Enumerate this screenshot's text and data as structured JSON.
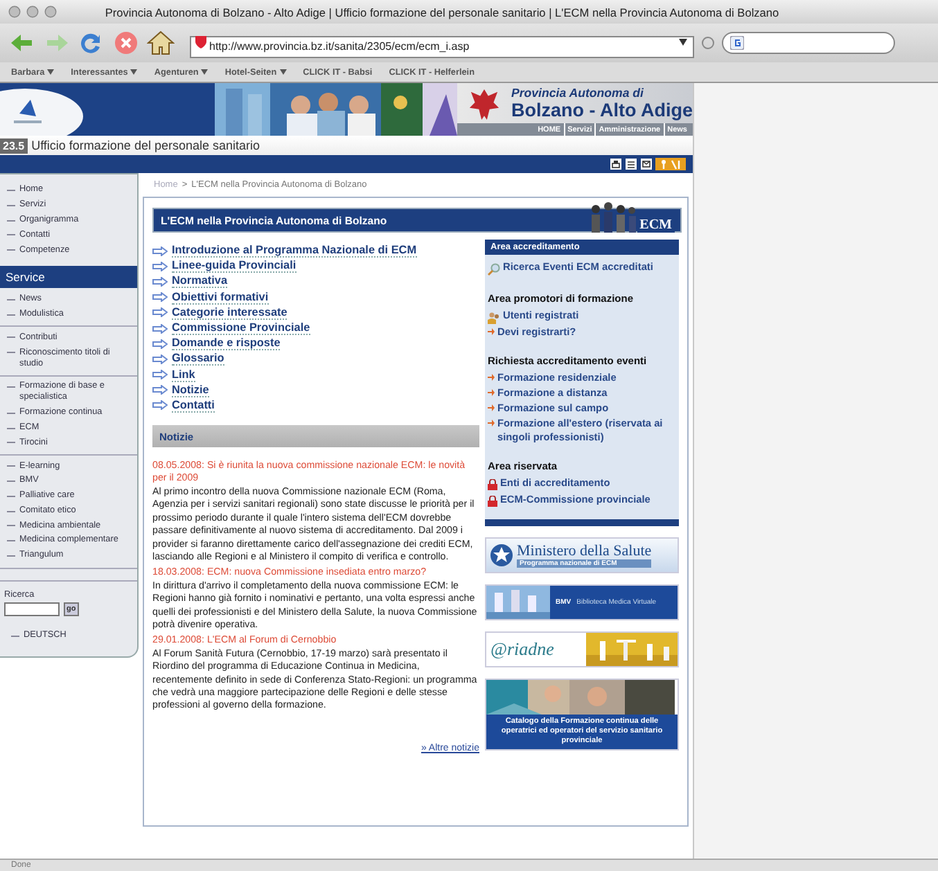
{
  "window": {
    "title": "Provincia Autonoma di Bolzano - Alto Adige | Ufficio formazione del personale sanitario | L'ECM nella Provincia Autonoma di Bolzano"
  },
  "toolbar": {
    "url": "http://www.provincia.bz.it/sanita/2305/ecm/ecm_i.asp"
  },
  "bookmarks": [
    {
      "label": "Barbara",
      "menu": true
    },
    {
      "label": "Interessantes",
      "menu": true
    },
    {
      "label": "Agenturen",
      "menu": true
    },
    {
      "label": "Hotel-Seiten",
      "menu": true
    },
    {
      "label": "CLICK IT - Babsi",
      "menu": false
    },
    {
      "label": "CLICK IT - Helferlein",
      "menu": false
    }
  ],
  "header": {
    "province_line1": "Provincia Autonoma di",
    "province_line2": "Bolzano - Alto Adige",
    "nav": [
      "HOME",
      "Servizi",
      "Amministrazione",
      "News"
    ],
    "office_number": "23.5",
    "office_name": "Ufficio formazione del personale sanitario"
  },
  "sidebar": {
    "groups": [
      {
        "items": [
          "Home",
          "Servizi",
          "Organigramma",
          "Contatti",
          "Competenze"
        ]
      },
      {
        "heading": "Service",
        "items": [
          "News",
          "Modulistica"
        ]
      },
      {
        "items": [
          "Contributi",
          "Riconoscimento titoli di studio"
        ]
      },
      {
        "items": [
          "Formazione di base e specialistica",
          "Formazione continua",
          "ECM",
          "Tirocini"
        ]
      },
      {
        "items": [
          "E-learning",
          "BMV",
          "Palliative care",
          "Comitato etico",
          "Medicina ambientale",
          "Medicina complementare",
          "Triangulum"
        ]
      }
    ],
    "search": {
      "label": "Ricerca",
      "button": "go"
    },
    "language": "DEUTSCH"
  },
  "breadcrumb": {
    "items": [
      "Home",
      "L'ECM nella Provincia Autonoma di Bolzano"
    ],
    "separator": ">"
  },
  "main": {
    "title": "L'ECM nella Provincia Autonoma di Bolzano",
    "logo": "ECM",
    "links": [
      "Introduzione al Programma Nazionale di ECM",
      "Linee-guida Provinciali",
      "Normativa",
      "Obiettivi formativi",
      "Categorie interessate",
      "Commissione Provinciale",
      "Domande e risposte",
      "Glossario",
      "Link",
      "Notizie",
      "Contatti"
    ],
    "news_heading": "Notizie",
    "news": [
      {
        "headline": "08.05.2008: Si è riunita la nuova commissione nazionale ECM: le novità per il 2009",
        "body": "Al primo incontro della nuova Commissione nazionale ECM (Roma, Agenzia per i servizi sanitari regionali) sono state discusse le priorità per il prossimo periodo durante il quale l'intero sistema dell'ECM dovrebbe passare definitivamente al nuovo sistema di accreditamento. Dal 2009 i provider si faranno direttamente carico dell'assegnazione dei crediti ECM, lasciando alle Regioni e al Ministero il compito di verifica e controllo."
      },
      {
        "headline": "18.03.2008: ECM: nuova Commissione insediata entro marzo?",
        "body": "In dirittura d'arrivo il completamento della nuova commissione ECM: le Regioni hanno già fornito i nominativi e pertanto, una volta espressi anche quelli dei professionisti e del Ministero della Salute, la nuova Commissione potrà divenire operativa."
      },
      {
        "headline": "29.01.2008: L'ECM al Forum di Cernobbio",
        "body": "Al Forum Sanità Futura (Cernobbio, 17-19 marzo) sarà presentato il Riordino del programma di Educazione Continua in Medicina, recentemente definito in sede di Conferenza Stato-Regioni: un programma che vedrà una maggiore partecipazione delle Regioni e delle stesse professioni al governo della formazione."
      }
    ],
    "more": "» Altre notizie"
  },
  "right_panel": {
    "heading": "Area accreditamento",
    "sections": [
      {
        "items": [
          {
            "kind": "search",
            "label": "Ricerca Eventi ECM accreditati"
          }
        ]
      },
      {
        "title": "Area promotori di formazione",
        "items": [
          {
            "kind": "users",
            "label": "Utenti registrati"
          },
          {
            "kind": "arrow",
            "label": "Devi registrarti?"
          }
        ]
      },
      {
        "title": "Richiesta accreditamento eventi",
        "items": [
          {
            "kind": "arrow",
            "label": "Formazione residenziale"
          },
          {
            "kind": "arrow",
            "label": "Formazione a distanza"
          },
          {
            "kind": "arrow",
            "label": "Formazione sul campo"
          },
          {
            "kind": "arrow",
            "label": "Formazione all'estero (riservata ai singoli professionisti)"
          }
        ]
      },
      {
        "title": "Area riservata",
        "items": [
          {
            "kind": "lock",
            "label": "Enti di accreditamento"
          },
          {
            "kind": "lock",
            "label": "ECM-Commissione provinciale"
          }
        ]
      }
    ]
  },
  "banners": [
    {
      "kind": "ministero",
      "title": "Ministero della Salute",
      "subtitle": "Programma nazionale di ECM"
    },
    {
      "kind": "bmv",
      "title": "BMV",
      "subtitle": "Biblioteca Medica Virtuale"
    },
    {
      "kind": "ariadne",
      "title": "@riadne"
    },
    {
      "kind": "catalogo",
      "caption": "Catalogo della Formazione continua delle operatrici ed operatori del servizio sanitario provinciale"
    }
  ],
  "status_bar": "Done"
}
